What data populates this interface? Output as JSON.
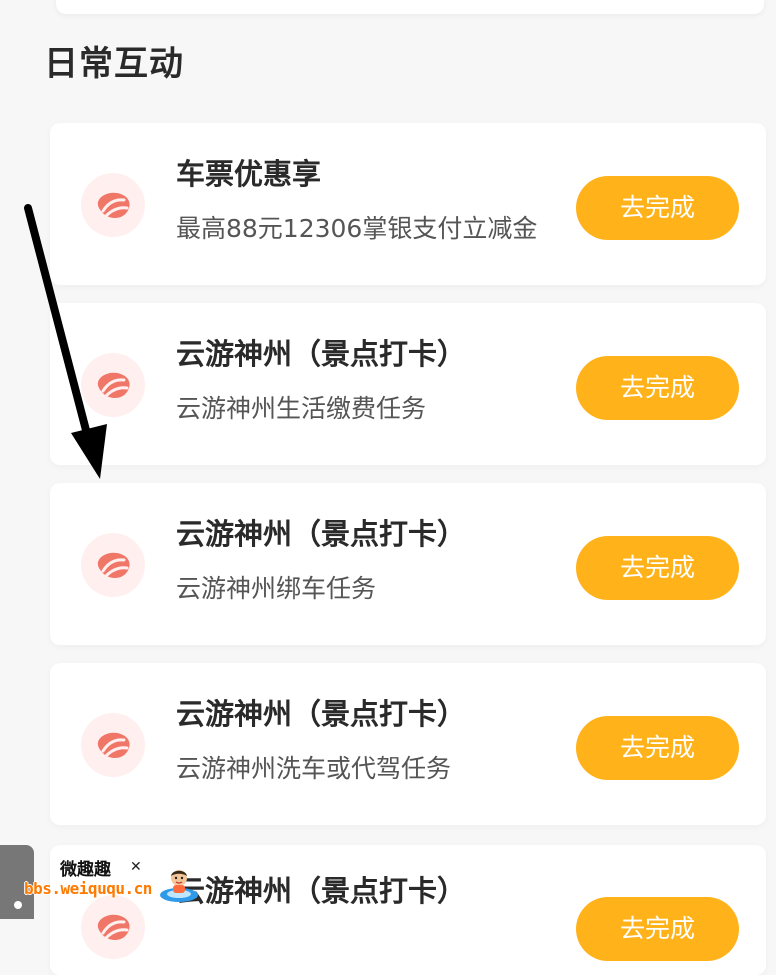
{
  "section": {
    "title": "日常互动"
  },
  "tasks": [
    {
      "icon": "bean-icon",
      "title": "车票优惠享",
      "description": "最高88元12306掌银支付立减金",
      "button_label": "去完成"
    },
    {
      "icon": "bean-icon",
      "title": "云游神州（景点打卡）",
      "description": "云游神州生活缴费任务",
      "button_label": "去完成"
    },
    {
      "icon": "bean-icon",
      "title": "云游神州（景点打卡）",
      "description": "云游神州绑车任务",
      "button_label": "去完成"
    },
    {
      "icon": "bean-icon",
      "title": "云游神州（景点打卡）",
      "description": "云游神州洗车或代驾任务",
      "button_label": "去完成"
    },
    {
      "icon": "bean-icon",
      "title": "云游神州（景点打卡）",
      "button_label": "去完成"
    }
  ],
  "annotation": {
    "icon": "arrow-down-icon",
    "color": "#000000"
  },
  "watermark": {
    "name": "微趣趣",
    "url": "bbs.weiququ.cn"
  },
  "colors": {
    "accent": "#ffb21a",
    "icon": "#f07668",
    "icon_background": "#fff0ef",
    "page_background": "#f7f7f7"
  }
}
